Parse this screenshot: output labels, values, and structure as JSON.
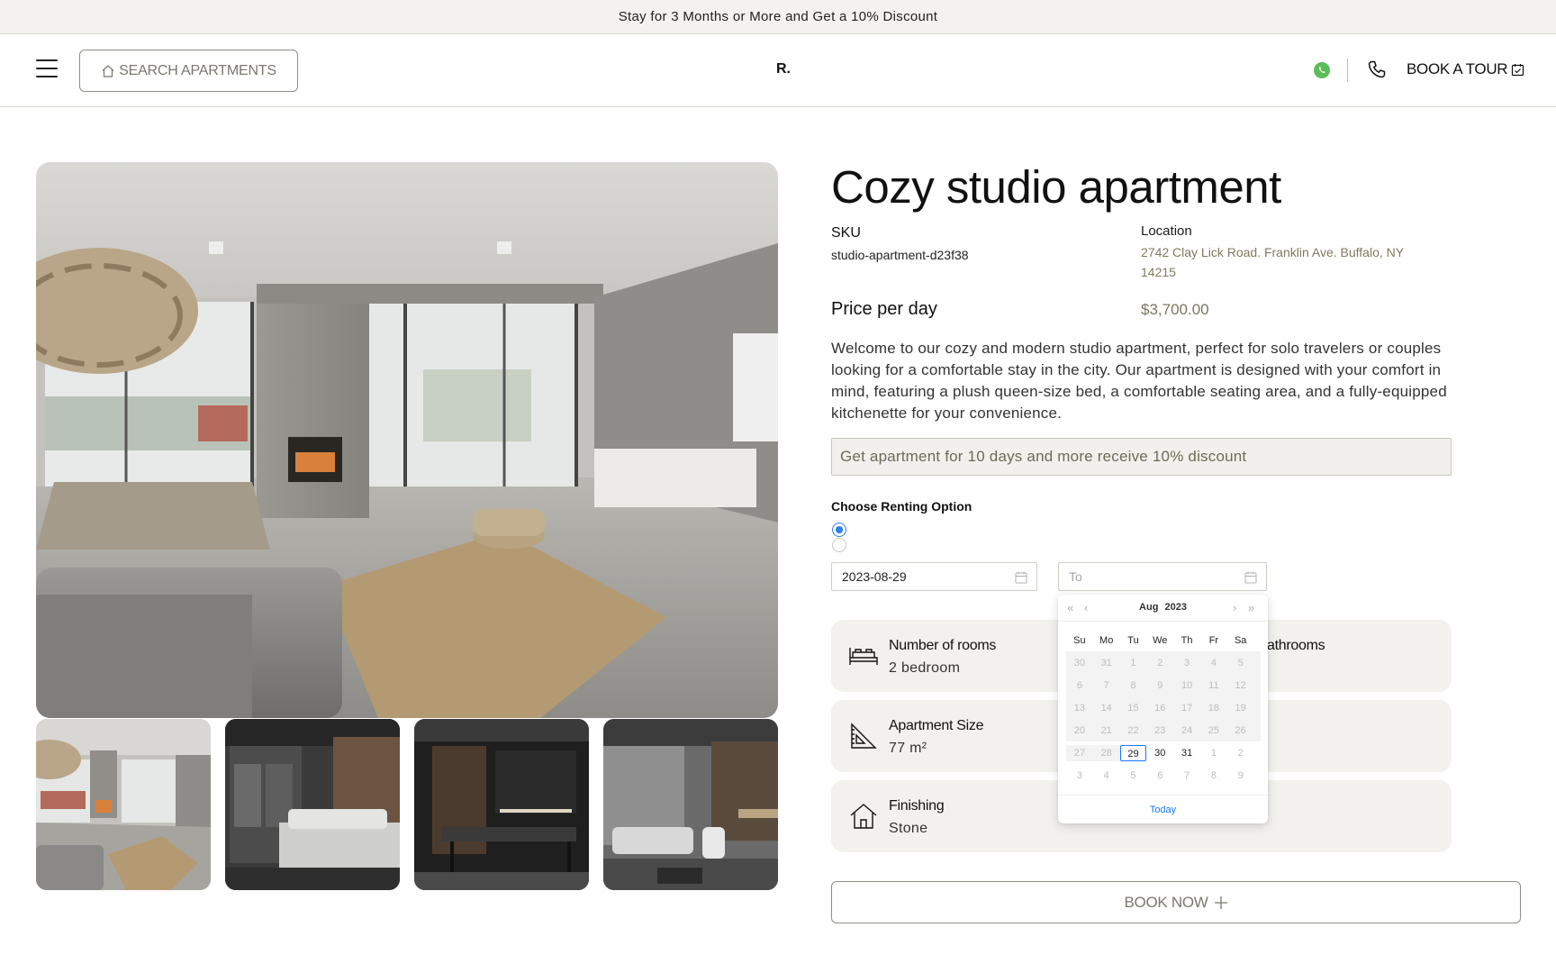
{
  "promo_bar": {
    "text": "Stay for 3 Months or More and Get a 10% Discount"
  },
  "header": {
    "search_label": "SEARCH APARTMENTS",
    "logo_text": "R.",
    "book_tour_label": "BOOK A TOUR",
    "whatsapp_color": "#5bbd59"
  },
  "gallery": {
    "thumbnails": [
      "living-room",
      "bedroom",
      "kitchen",
      "bathroom"
    ]
  },
  "listing": {
    "title": "Cozy studio apartment",
    "sku_label": "SKU",
    "sku_value": "studio-apartment-d23f38",
    "location_label": "Location",
    "location_value": "2742 Clay Lick Road. Franklin Ave. Buffalo, NY 14215",
    "price_label": "Price per day",
    "price_value": "$3,700.00",
    "description": "Welcome to our cozy and modern studio apartment, perfect for solo travelers or couples looking for a comfortable stay in the city. Our apartment is designed with your comfort in mind, featuring a plush queen-size bed, a comfortable seating area, and a fully-equipped kitchenette for your convenience.",
    "discount_text": "Get apartment for 10 days and more receive 10% discount"
  },
  "renting": {
    "label": "Choose Renting Option",
    "from_value": "2023-08-29",
    "to_placeholder": "To"
  },
  "features": [
    {
      "label": "Number of rooms",
      "value": "2 bedroom",
      "right_label": "athrooms"
    },
    {
      "label": "Apartment Size",
      "value": "77 m²"
    },
    {
      "label": "Finishing",
      "value": "Stone"
    }
  ],
  "book_now_label": "BOOK NOW",
  "calendar": {
    "month": "Aug",
    "year": "2023",
    "weekdays": [
      "Su",
      "Mo",
      "Tu",
      "We",
      "Th",
      "Fr",
      "Sa"
    ],
    "rows": [
      [
        "30",
        "31",
        "1",
        "2",
        "3",
        "4",
        "5"
      ],
      [
        "6",
        "7",
        "8",
        "9",
        "10",
        "11",
        "12"
      ],
      [
        "13",
        "14",
        "15",
        "16",
        "17",
        "18",
        "19"
      ],
      [
        "20",
        "21",
        "22",
        "23",
        "24",
        "25",
        "26"
      ],
      [
        "27",
        "28",
        "29",
        "30",
        "31",
        "1",
        "2"
      ],
      [
        "3",
        "4",
        "5",
        "6",
        "7",
        "8",
        "9"
      ]
    ],
    "today_label": "Today"
  }
}
